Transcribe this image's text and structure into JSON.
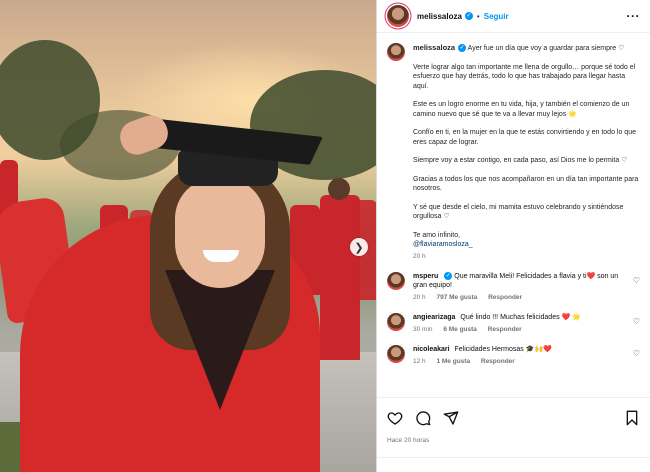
{
  "post": {
    "username": "melissaloza",
    "follow_label": "Seguir",
    "caption": {
      "lines": [
        "Ayer fue un día que voy a guardar para siempre ♡",
        "Verte lograr algo tan importante me llena de orgullo… porque sé todo el esfuerzo que hay detrás, todo lo que has trabajado para llegar hasta aquí.",
        "Este es un logro enorme en tu vida, hija, y también el comienzo de un camino nuevo que sé que te va a llevar muy lejos 🌟",
        "Confío en ti, en la mujer en la que te estás convirtiendo y en todo lo que eres capaz de lograr.",
        "Siempre voy a estar contigo, en cada paso, así Dios me lo permita ♡",
        "Gracias a todos los que nos acompañaron en un día tan importante para nosotros.",
        "Y sé que desde el cielo, mi mamita estuvo celebrando y sintiéndose orgullosa ♡",
        "Te amo infinito,"
      ],
      "mention": "@flaviaramosloza_",
      "time": "20 h"
    },
    "comments": [
      {
        "username": "msperu",
        "text": "Que maravilla Meli! Felicidades a flavia y ti❤️ son un gran equipo!",
        "time": "20 h",
        "likes": "797 Me gusta",
        "reply": "Responder"
      },
      {
        "username": "angiearizaga",
        "text": "Qué lindo !!! Muchas felicidades ❤️ 🌟",
        "time": "30 min",
        "likes": "6 Me gusta",
        "reply": "Responder"
      },
      {
        "username": "nicoleakari",
        "text": "Felicidades Hermosas 🎓🙌❤️",
        "time": "12 h",
        "likes": "1 Me gusta",
        "reply": "Responder"
      }
    ],
    "posted_ago": "Hace 20 horas",
    "icons": {
      "like": "heart-icon",
      "comment": "comment-icon",
      "share": "share-icon",
      "save": "bookmark-icon",
      "more": "more-icon",
      "next": "chevron-right-icon",
      "verified": "verified-badge-icon"
    },
    "colors": {
      "link": "#0095f6",
      "verified": "#0095f6",
      "heart": "#e0245e"
    }
  }
}
